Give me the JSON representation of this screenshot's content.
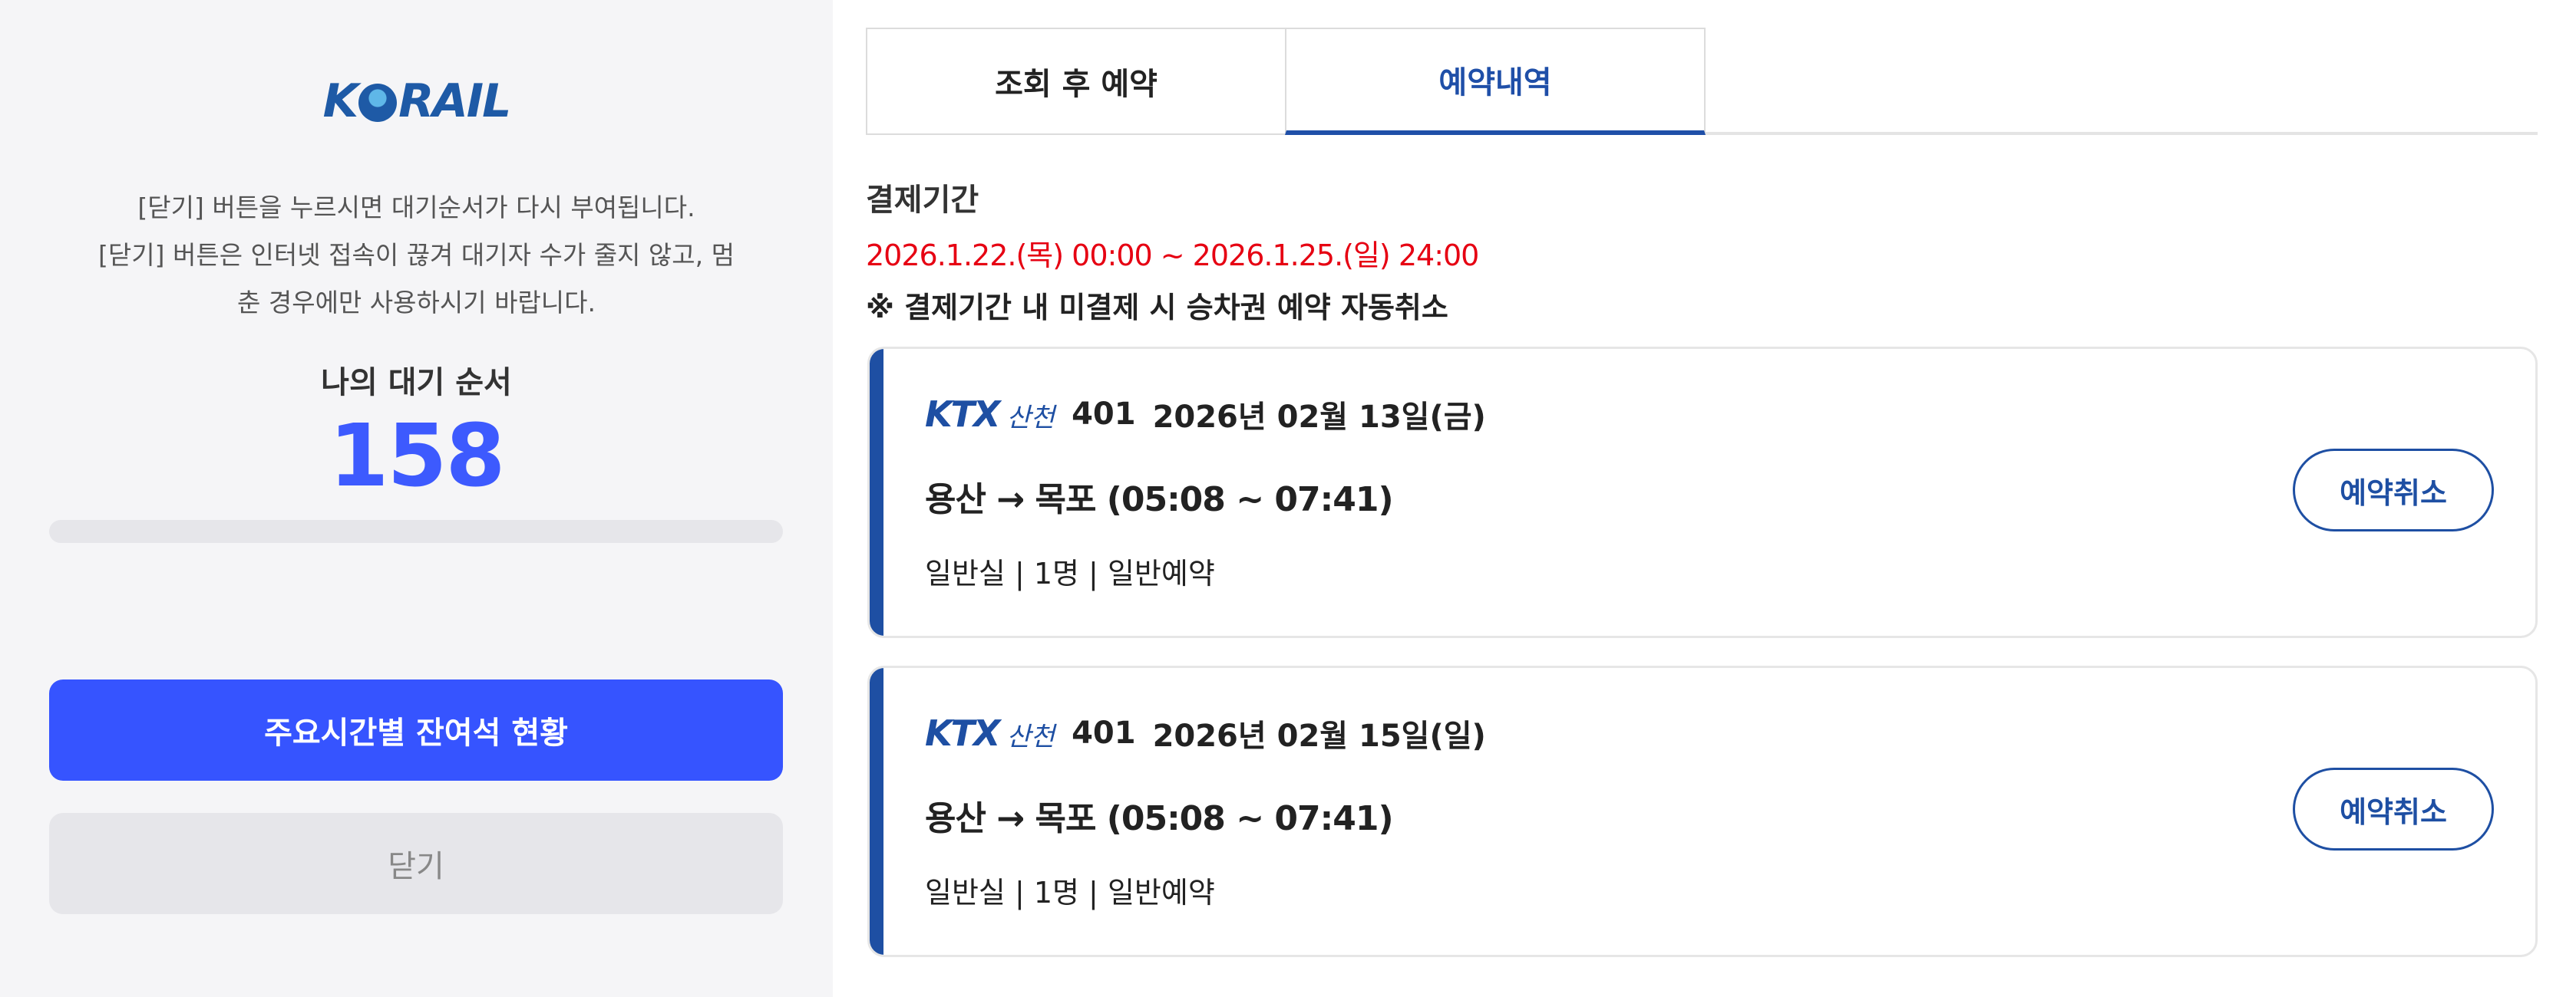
{
  "brand": {
    "logo_text_before": "K",
    "logo_text_after": "RAIL"
  },
  "waiting": {
    "notice_lines": [
      "[닫기] 버튼을 누르시면 대기순서가 다시 부여됩니다.",
      "[닫기] 버튼은 인터넷 접속이 끊겨 대기자 수가 줄지 않고, 멈",
      "춘 경우에만 사용하시기 바랍니다."
    ],
    "queue_label": "나의 대기 순서",
    "queue_number": "158",
    "progress_fraction": 0,
    "seat_status_button": "주요시간별 잔여석 현황",
    "close_button": "닫기"
  },
  "tabs": [
    {
      "label": "조회 후 예약",
      "active": false
    },
    {
      "label": "예약내역",
      "active": true
    }
  ],
  "payment": {
    "title": "결제기간",
    "range": "2026.1.22.(목) 00:00 ~ 2026.1.25.(일) 24:00",
    "note": "※ 결제기간 내 미결제 시 승차권 예약 자동취소"
  },
  "reservations": [
    {
      "train_type": "KTX",
      "train_line": "산천",
      "train_no": "401",
      "date": "2026년 02월 13일(금)",
      "route": "용산 → 목포 (05:08 ~ 07:41)",
      "detail": "일반실 | 1명 | 일반예약",
      "cancel_label": "예약취소"
    },
    {
      "train_type": "KTX",
      "train_line": "산천",
      "train_no": "401",
      "date": "2026년 02월 15일(일)",
      "route": "용산 → 목포 (05:08 ~ 07:41)",
      "detail": "일반실 | 1명 | 일반예약",
      "cancel_label": "예약취소"
    }
  ],
  "colors": {
    "accent_blue": "#3654ff",
    "korail_blue": "#1e4fa3",
    "warning_red": "#e60012"
  }
}
